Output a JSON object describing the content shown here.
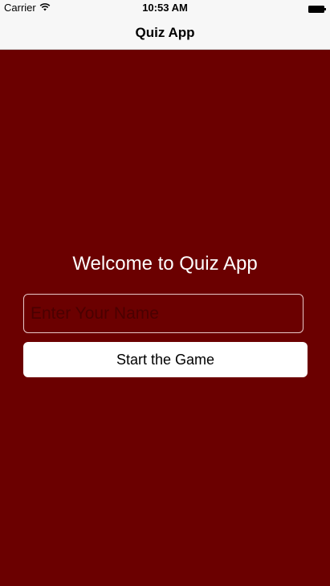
{
  "status_bar": {
    "carrier": "Carrier",
    "time": "10:53 AM",
    "wifi_icon": "wifi-icon",
    "battery_icon": "battery-icon"
  },
  "nav": {
    "title": "Quiz App"
  },
  "main": {
    "welcome_text": "Welcome to Quiz App",
    "name_input": {
      "value": "",
      "placeholder": "Enter Your Name"
    },
    "start_button_label": "Start the Game"
  },
  "colors": {
    "background": "#6b0000",
    "nav_background": "#f7f7f7",
    "button_background": "#ffffff",
    "welcome_text": "#ffffff"
  }
}
